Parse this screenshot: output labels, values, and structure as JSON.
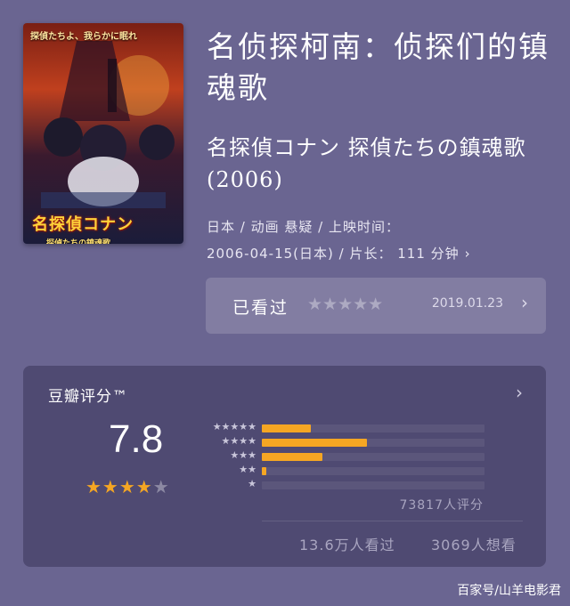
{
  "poster": {
    "tagline": "探偵たちよ、我らかに眠れ",
    "logo": "名探偵コナン",
    "subtitle": "探偵たちの鎮魂歌"
  },
  "movie": {
    "title": "名侦探柯南：侦探们的镇魂歌",
    "original_title": "名探偵コナン 探偵たちの鎮魂歌 (2006)",
    "meta_line1": "日本 / 动画 悬疑 / 上映时间：",
    "meta_line2": "2006-04-15(日本) / 片长： 111 分钟",
    "meta_chevron": "›"
  },
  "watched": {
    "label": "已看过",
    "stars": "★★★★★",
    "user_rating": 0,
    "date": "2019.01.23",
    "chevron": "›"
  },
  "rating": {
    "title": "豆瓣评分™",
    "chevron": "›",
    "score": "7.8",
    "stars_on": "★★★★",
    "stars_off": "★",
    "distribution": [
      {
        "stars": "★★★★★",
        "fraction": 0.22
      },
      {
        "stars": "★★★★",
        "fraction": 0.47
      },
      {
        "stars": "★★★",
        "fraction": 0.27
      },
      {
        "stars": "★★",
        "fraction": 0.02
      },
      {
        "stars": "★",
        "fraction": 0.0
      }
    ],
    "votes": "73817人评分",
    "seen": "13.6万人看过",
    "want": "3069人想看"
  },
  "colors": {
    "background": "#6a6591",
    "card": "#4f4a72",
    "accent": "#f5a623"
  },
  "watermark": "百家号/山羊电影君"
}
